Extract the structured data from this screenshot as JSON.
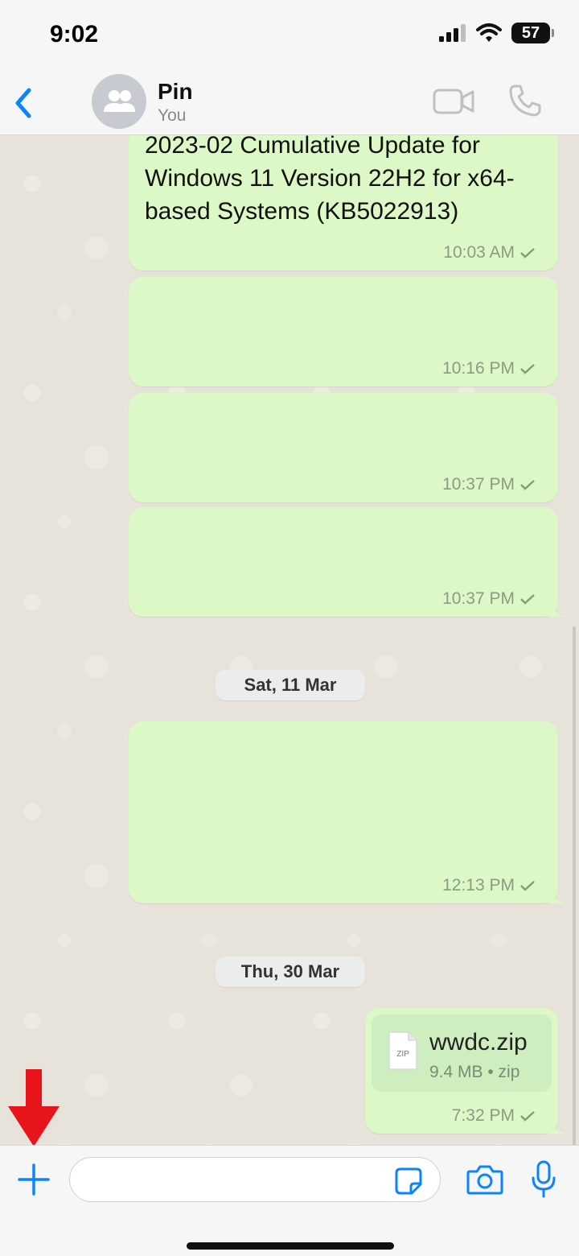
{
  "status_bar": {
    "time": "9:02",
    "battery": "57"
  },
  "header": {
    "contact_name": "Pin",
    "contact_subtitle": "You"
  },
  "messages": [
    {
      "text": "2023-02 Cumulative Update for Windows 11 Version 22H2 for x64-based Systems (KB5022913)",
      "time": "10:03 AM"
    },
    {
      "text": "",
      "time": "10:16 PM"
    },
    {
      "text": "",
      "time": "10:37 PM"
    },
    {
      "text": "",
      "time": "10:37 PM"
    },
    {
      "text": "",
      "time": "12:13 PM"
    },
    {
      "file_name": "wwdc.zip",
      "file_info": "9.4 MB • zip",
      "file_type_label": "ZIP",
      "time": "7:32 PM"
    }
  ],
  "date_separators": [
    "Sat, 11 Mar",
    "Thu, 30 Mar"
  ],
  "colors": {
    "accent": "#0a84ff",
    "outgoing_bubble": "#dcf8c6",
    "annotation_arrow": "#e8141c"
  },
  "icons": {
    "back": "chevron-left-icon",
    "avatar": "group-icon",
    "video": "video-camera-icon",
    "phone": "phone-icon",
    "plus": "plus-icon",
    "sticker": "sticker-icon",
    "camera": "camera-icon",
    "mic": "microphone-icon"
  }
}
